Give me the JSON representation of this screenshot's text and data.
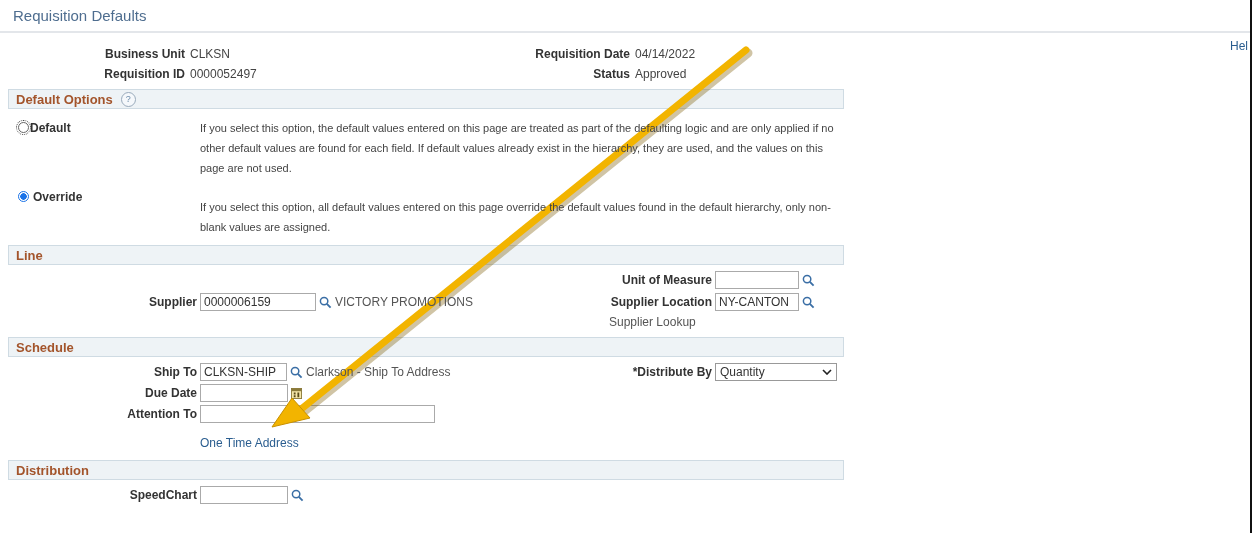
{
  "page_title": "Requisition Defaults",
  "help_link": "Hel",
  "header": {
    "left": [
      {
        "label": "Business Unit",
        "value": "CLKSN"
      },
      {
        "label": "Requisition ID",
        "value": "0000052497"
      }
    ],
    "right": [
      {
        "label": "Requisition Date",
        "value": "04/14/2022"
      },
      {
        "label": "Status",
        "value": "Approved"
      }
    ]
  },
  "default_options": {
    "title": "Default Options",
    "help_icon": "?",
    "options": [
      {
        "label": "Default",
        "selected": false,
        "description": "If you select this option, the default values entered on this page are treated as part of the defaulting logic and are only applied if no other default values are found for each field. If default values already exist in the hierarchy, they are used, and the values on this page are not used."
      },
      {
        "label": "Override",
        "selected": true,
        "description": "If you select this option, all default values entered on this page override the default values found in the default hierarchy, only non-blank values are assigned."
      }
    ]
  },
  "line": {
    "title": "Line",
    "unit_of_measure": {
      "label": "Unit of Measure"
    },
    "supplier": {
      "label": "Supplier",
      "value": "0000006159",
      "name": "VICTORY PROMOTIONS"
    },
    "supplier_location": {
      "label": "Supplier Location",
      "value": "NY-CANTON"
    },
    "supplier_lookup": "Supplier Lookup"
  },
  "schedule": {
    "title": "Schedule",
    "ship_to": {
      "label": "Ship To",
      "value": "CLKSN-SHIP",
      "description": "Clarkson - Ship To Address"
    },
    "distribute_by": {
      "label": "*Distribute By",
      "value": "Quantity"
    },
    "due_date": {
      "label": "Due Date"
    },
    "attention_to": {
      "label": "Attention To"
    },
    "one_time_address": "One Time Address"
  },
  "distribution": {
    "title": "Distribution",
    "speedchart": {
      "label": "SpeedChart"
    }
  }
}
